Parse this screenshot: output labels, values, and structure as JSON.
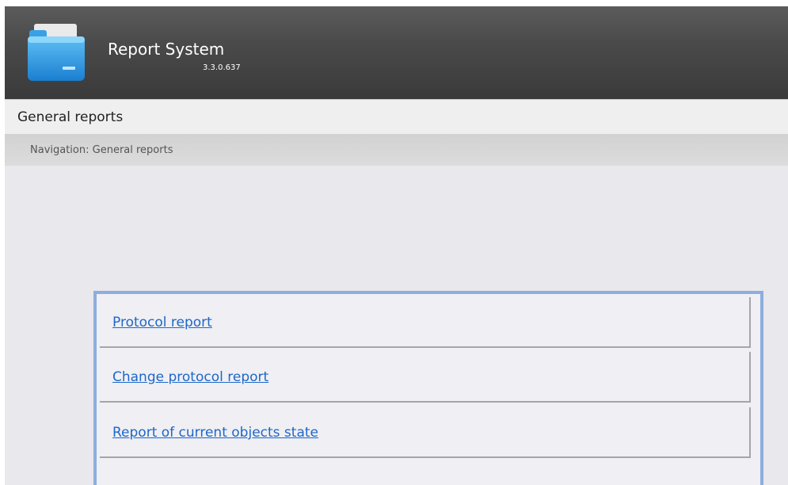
{
  "header": {
    "title": "Report System",
    "version": "3.3.0.637",
    "logo_icon": "folder-icon"
  },
  "section": {
    "title": "General reports"
  },
  "breadcrumb": {
    "text": "Navigation: General reports"
  },
  "reports": {
    "items": [
      {
        "label": "Protocol report"
      },
      {
        "label": "Change protocol report"
      },
      {
        "label": "Report of current objects state"
      }
    ]
  },
  "colors": {
    "header_bg": "#4a4a4a",
    "link": "#1e67c8",
    "panel_border": "#8daedc",
    "main_bg": "#e8e8ed"
  }
}
